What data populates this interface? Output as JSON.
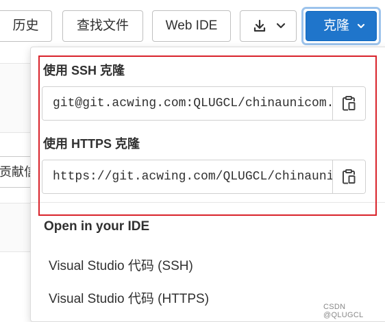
{
  "toolbar": {
    "history_label": "历史",
    "find_file_label": "查找文件",
    "web_ide_label": "Web IDE",
    "clone_label": "克隆"
  },
  "background": {
    "partial_input_text": "贡献信"
  },
  "clone_dropdown": {
    "ssh": {
      "title": "使用 SSH 克隆",
      "url": "git@git.acwing.com:QLUGCL/chinaunicom.git"
    },
    "https": {
      "title": "使用 HTTPS 克隆",
      "url": "https://git.acwing.com/QLUGCL/chinaunicom.git"
    },
    "ide": {
      "title": "Open in your IDE",
      "items": [
        {
          "label": "Visual Studio 代码 (SSH)"
        },
        {
          "label": "Visual Studio 代码 (HTTPS)"
        }
      ]
    }
  },
  "watermark": "CSDN @QLUGCL",
  "colors": {
    "clone_button": "#1f75cb",
    "highlight_box": "#d9222a"
  },
  "icons": [
    "download-icon",
    "chevron-down-icon",
    "clipboard-icon"
  ]
}
